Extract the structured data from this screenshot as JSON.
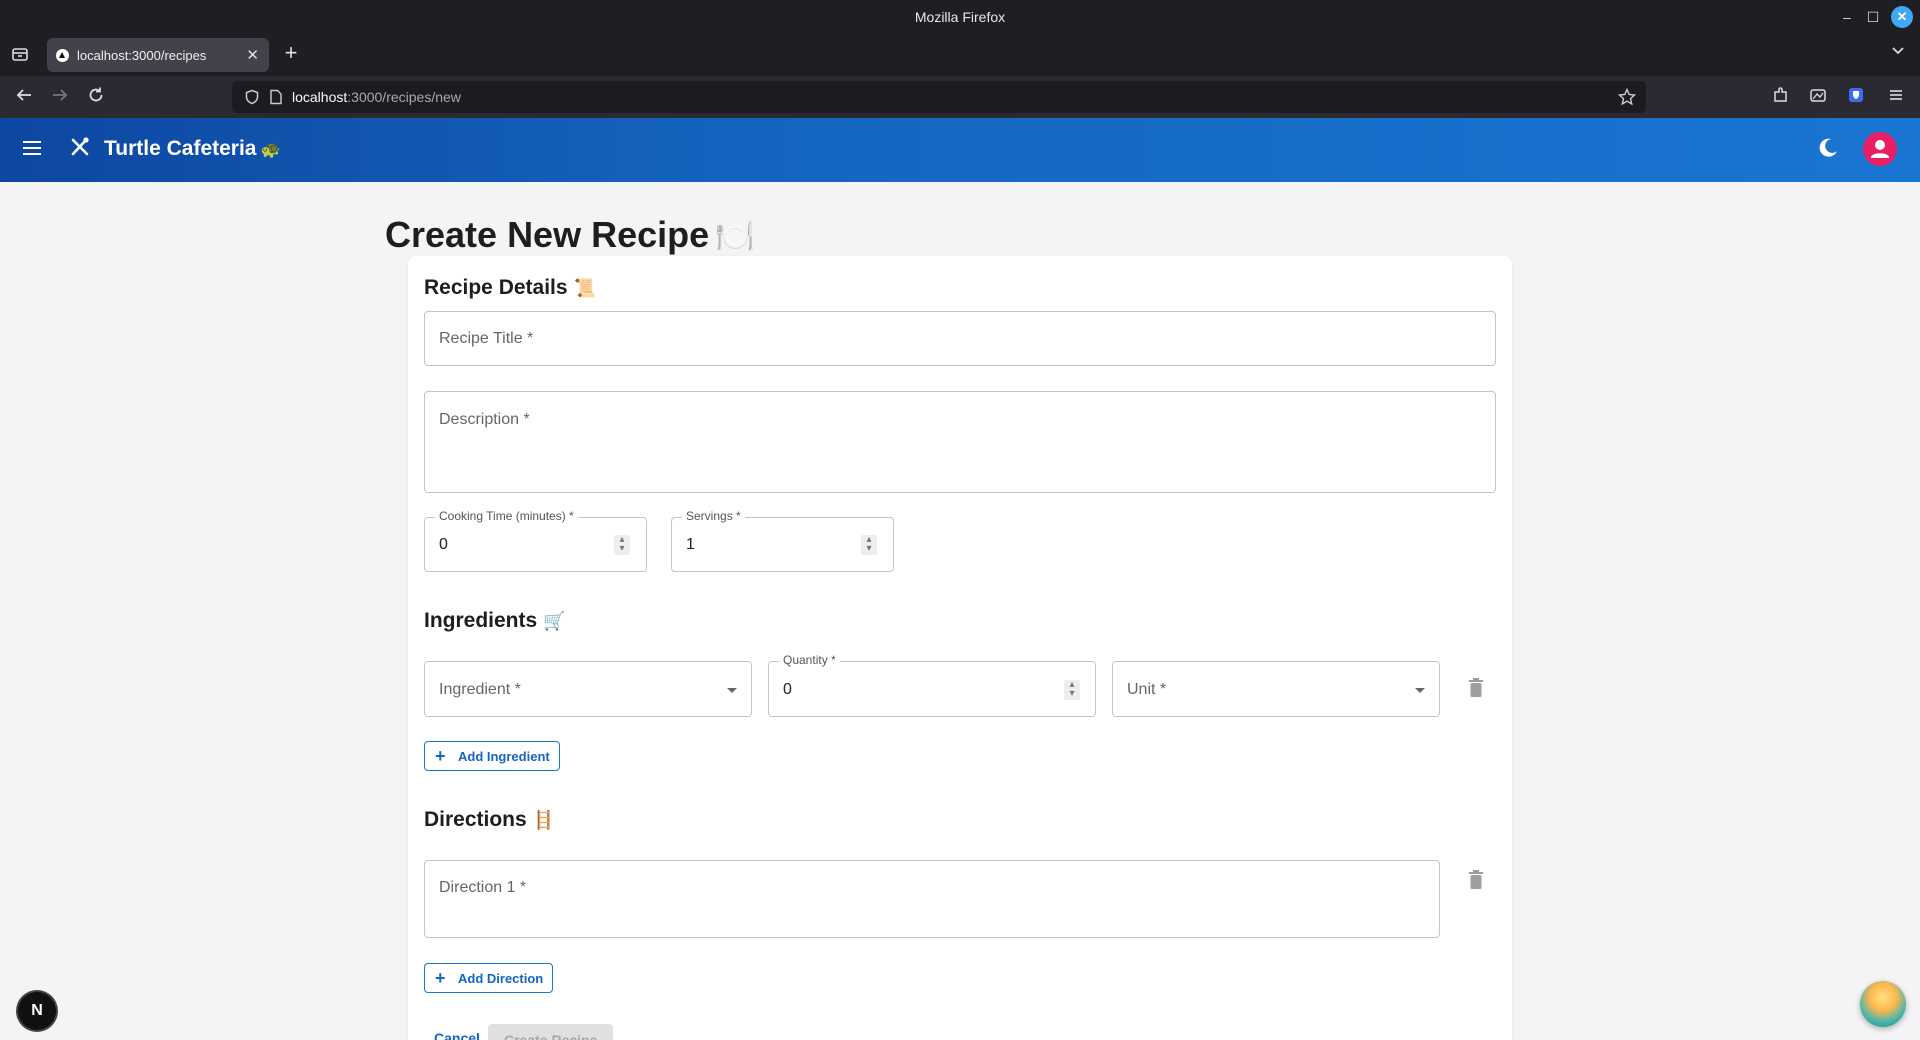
{
  "window": {
    "title": "Mozilla Firefox",
    "minimize": "–",
    "maximize": "☐",
    "close": "✕"
  },
  "tabs": [
    {
      "label": "localhost:3000/recipes",
      "close": "✕"
    }
  ],
  "new_tab": "+",
  "address": {
    "host": "localhost",
    "rest": ":3000/recipes/new"
  },
  "app": {
    "brand": "Turtle Cafeteria",
    "brand_emoji": "🐢"
  },
  "page": {
    "title": "Create New Recipe",
    "title_emoji": "🍽️"
  },
  "recipe_details": {
    "title": "Recipe Details",
    "emoji": "📜",
    "recipe_title_placeholder": "Recipe Title *",
    "description_placeholder": "Description *",
    "cooking_time_label": "Cooking Time (minutes) *",
    "cooking_time_value": "0",
    "servings_label": "Servings *",
    "servings_value": "1"
  },
  "ingredients": {
    "title": "Ingredients",
    "emoji": "🛒",
    "ingredient_placeholder": "Ingredient *",
    "quantity_label": "Quantity *",
    "quantity_value": "0",
    "unit_placeholder": "Unit *",
    "add_label": "Add Ingredient"
  },
  "directions": {
    "title": "Directions",
    "emoji": "🪜",
    "direction_placeholder": "Direction 1 *",
    "add_label": "Add Direction"
  },
  "actions": {
    "cancel": "Cancel",
    "create": "Create Recipe"
  },
  "dev_badge": "N",
  "colors": {
    "appbar_start": "#0d47a1",
    "appbar_end": "#1976d2",
    "primary": "#1565c0",
    "avatar": "#e91e63"
  }
}
